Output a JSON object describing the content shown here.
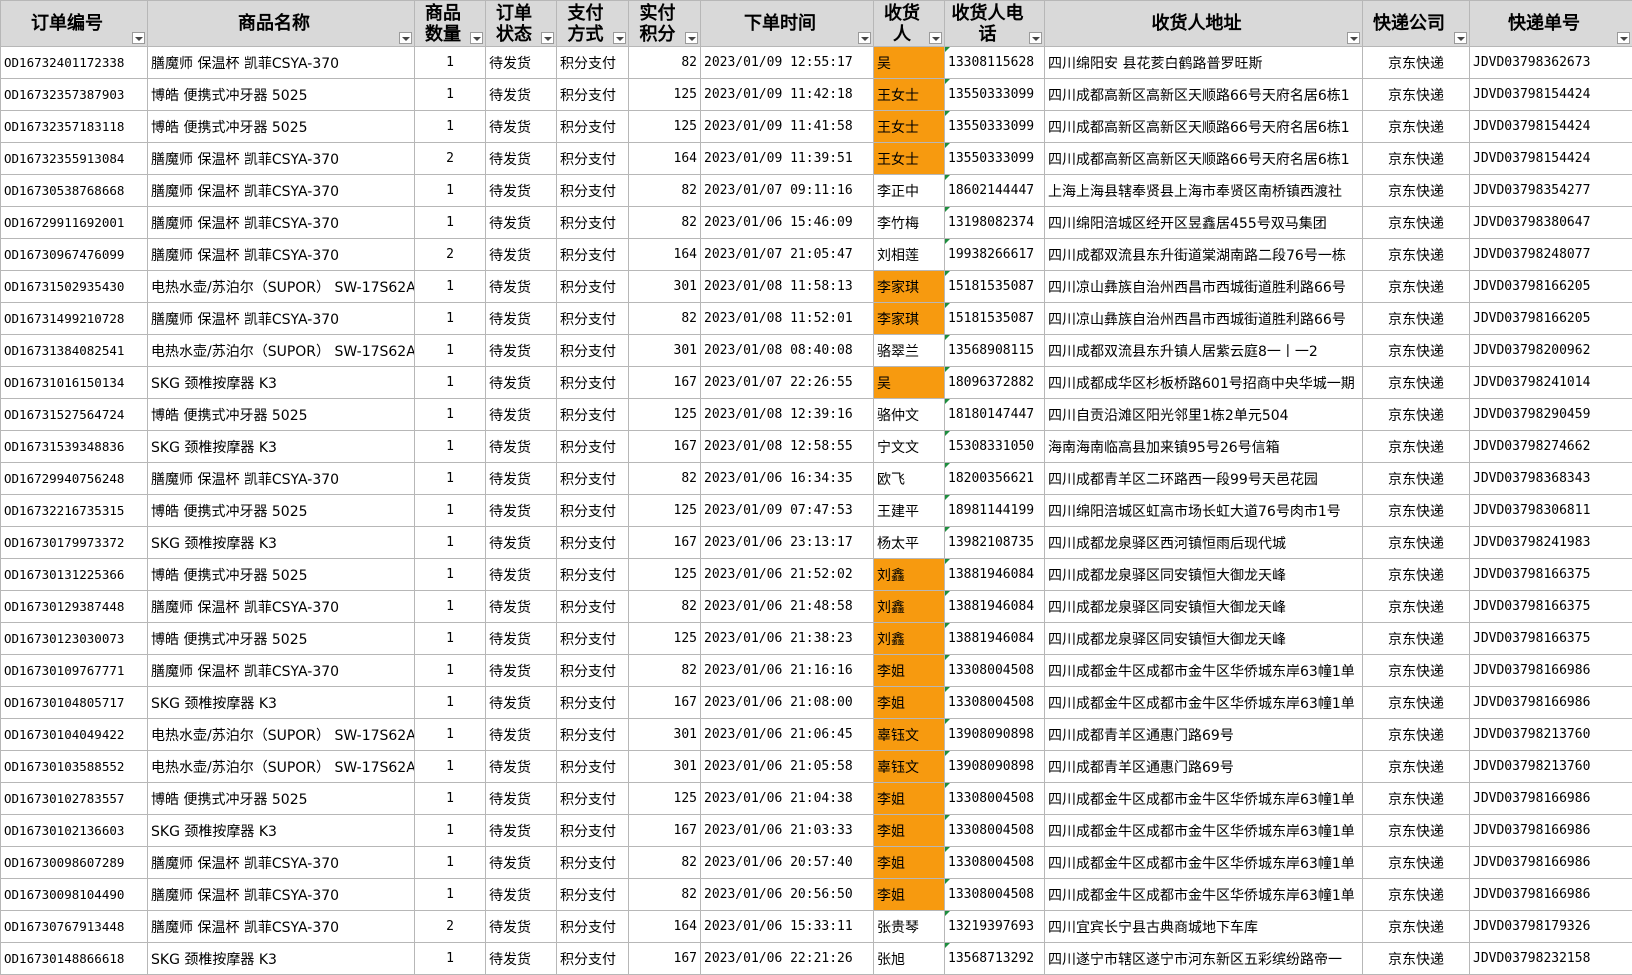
{
  "colors": {
    "header_bg": "#d9d9d9",
    "highlight": "#f79a0f",
    "grid": "#b7b7b7",
    "comment_marker": "#1e8e3e"
  },
  "icons": {
    "filter": "filter-dropdown-icon"
  },
  "columns": [
    {
      "key": "order_id",
      "label": "订单编号"
    },
    {
      "key": "product",
      "label": "商品名称"
    },
    {
      "key": "qty",
      "label": "商品数量"
    },
    {
      "key": "status",
      "label": "订单状态"
    },
    {
      "key": "payment",
      "label": "支付方式"
    },
    {
      "key": "points",
      "label": "实付积分"
    },
    {
      "key": "time",
      "label": "下单时间"
    },
    {
      "key": "receiver",
      "label": "收货人"
    },
    {
      "key": "phone",
      "label": "收货人电话"
    },
    {
      "key": "address",
      "label": "收货人地址"
    },
    {
      "key": "courier",
      "label": "快递公司"
    },
    {
      "key": "tracking",
      "label": "快递单号"
    }
  ],
  "rows": [
    {
      "order_id": "OD16732401172338",
      "product": "膳魔师 保温杯 凯菲CSYA-370",
      "qty": "1",
      "status": "待发货",
      "payment": "积分支付",
      "points": "82",
      "time": "2023/01/09 12:55:17",
      "receiver": "吴",
      "highlight": true,
      "phone": "13308115628",
      "address": "四川绵阳安  县花荄白鹤路普罗旺斯",
      "courier": "京东快递",
      "tracking": "JDVD03798362673"
    },
    {
      "order_id": "OD16732357387903",
      "product": "博皓 便携式冲牙器 5025",
      "qty": "1",
      "status": "待发货",
      "payment": "积分支付",
      "points": "125",
      "time": "2023/01/09 11:42:18",
      "receiver": "王女士",
      "highlight": true,
      "phone": "13550333099",
      "address": "四川成都高新区高新区天顺路66号天府名居6栋1",
      "courier": "京东快递",
      "tracking": "JDVD03798154424"
    },
    {
      "order_id": "OD16732357183118",
      "product": "博皓 便携式冲牙器 5025",
      "qty": "1",
      "status": "待发货",
      "payment": "积分支付",
      "points": "125",
      "time": "2023/01/09 11:41:58",
      "receiver": "王女士",
      "highlight": true,
      "phone": "13550333099",
      "address": "四川成都高新区高新区天顺路66号天府名居6栋1",
      "courier": "京东快递",
      "tracking": "JDVD03798154424"
    },
    {
      "order_id": "OD16732355913084",
      "product": "膳魔师 保温杯 凯菲CSYA-370",
      "qty": "2",
      "status": "待发货",
      "payment": "积分支付",
      "points": "164",
      "time": "2023/01/09 11:39:51",
      "receiver": "王女士",
      "highlight": true,
      "phone": "13550333099",
      "address": "四川成都高新区高新区天顺路66号天府名居6栋1",
      "courier": "京东快递",
      "tracking": "JDVD03798154424"
    },
    {
      "order_id": "OD16730538768668",
      "product": "膳魔师 保温杯 凯菲CSYA-370",
      "qty": "1",
      "status": "待发货",
      "payment": "积分支付",
      "points": "82",
      "time": "2023/01/07 09:11:16",
      "receiver": "李正中",
      "highlight": false,
      "phone": "18602144447",
      "address": "上海上海县辖奉贤县上海市奉贤区南桥镇西渡社",
      "courier": "京东快递",
      "tracking": "JDVD03798354277"
    },
    {
      "order_id": "OD16729911692001",
      "product": "膳魔师 保温杯 凯菲CSYA-370",
      "qty": "1",
      "status": "待发货",
      "payment": "积分支付",
      "points": "82",
      "time": "2023/01/06 15:46:09",
      "receiver": "李竹梅",
      "highlight": false,
      "phone": "13198082374",
      "address": "四川绵阳涪城区经开区昱鑫居455号双马集团",
      "courier": "京东快递",
      "tracking": "JDVD03798380647"
    },
    {
      "order_id": "OD16730967476099",
      "product": "膳魔师 保温杯 凯菲CSYA-370",
      "qty": "2",
      "status": "待发货",
      "payment": "积分支付",
      "points": "164",
      "time": "2023/01/07 21:05:47",
      "receiver": "刘相莲",
      "highlight": false,
      "phone": "19938266617",
      "address": "四川成都双流县东升街道棠湖南路二段76号一栋",
      "courier": "京东快递",
      "tracking": "JDVD03798248077"
    },
    {
      "order_id": "OD16731502935430",
      "product": "电热水壶/苏泊尔（SUPOR） SW-17S62A",
      "qty": "1",
      "status": "待发货",
      "payment": "积分支付",
      "points": "301",
      "time": "2023/01/08 11:58:13",
      "receiver": "李家琪",
      "highlight": true,
      "phone": "15181535087",
      "address": "四川凉山彝族自治州西昌市西城街道胜利路66号",
      "courier": "京东快递",
      "tracking": "JDVD03798166205"
    },
    {
      "order_id": "OD16731499210728",
      "product": "膳魔师 保温杯 凯菲CSYA-370",
      "qty": "1",
      "status": "待发货",
      "payment": "积分支付",
      "points": "82",
      "time": "2023/01/08 11:52:01",
      "receiver": "李家琪",
      "highlight": true,
      "phone": "15181535087",
      "address": "四川凉山彝族自治州西昌市西城街道胜利路66号",
      "courier": "京东快递",
      "tracking": "JDVD03798166205"
    },
    {
      "order_id": "OD16731384082541",
      "product": "电热水壶/苏泊尔（SUPOR） SW-17S62A",
      "qty": "1",
      "status": "待发货",
      "payment": "积分支付",
      "points": "301",
      "time": "2023/01/08 08:40:08",
      "receiver": "骆翠兰",
      "highlight": false,
      "phone": "13568908115",
      "address": "四川成都双流县东升镇人居紫云庭8一丨一2",
      "courier": "京东快递",
      "tracking": "JDVD03798200962"
    },
    {
      "order_id": "OD16731016150134",
      "product": "SKG 颈椎按摩器 K3",
      "qty": "1",
      "status": "待发货",
      "payment": "积分支付",
      "points": "167",
      "time": "2023/01/07 22:26:55",
      "receiver": "吴",
      "highlight": true,
      "phone": "18096372882",
      "address": "四川成都成华区杉板桥路601号招商中央华城一期",
      "courier": "京东快递",
      "tracking": "JDVD03798241014"
    },
    {
      "order_id": "OD16731527564724",
      "product": "博皓 便携式冲牙器 5025",
      "qty": "1",
      "status": "待发货",
      "payment": "积分支付",
      "points": "125",
      "time": "2023/01/08 12:39:16",
      "receiver": "骆仲文",
      "highlight": false,
      "phone": "18180147447",
      "address": "四川自贡沿滩区阳光邻里1栋2单元504",
      "courier": "京东快递",
      "tracking": "JDVD03798290459"
    },
    {
      "order_id": "OD16731539348836",
      "product": "SKG 颈椎按摩器 K3",
      "qty": "1",
      "status": "待发货",
      "payment": "积分支付",
      "points": "167",
      "time": "2023/01/08 12:58:55",
      "receiver": "宁文文",
      "highlight": false,
      "phone": "15308331050",
      "address": "海南海南临高县加来镇95号26号信箱",
      "courier": "京东快递",
      "tracking": "JDVD03798274662"
    },
    {
      "order_id": "OD16729940756248",
      "product": "膳魔师 保温杯 凯菲CSYA-370",
      "qty": "1",
      "status": "待发货",
      "payment": "积分支付",
      "points": "82",
      "time": "2023/01/06 16:34:35",
      "receiver": "欧飞",
      "highlight": false,
      "phone": "18200356621",
      "address": "四川成都青羊区二环路西一段99号天邑花园",
      "courier": "京东快递",
      "tracking": "JDVD03798368343"
    },
    {
      "order_id": "OD16732216735315",
      "product": "博皓 便携式冲牙器 5025",
      "qty": "1",
      "status": "待发货",
      "payment": "积分支付",
      "points": "125",
      "time": "2023/01/09 07:47:53",
      "receiver": "王建平",
      "highlight": false,
      "phone": "18981144199",
      "address": "四川绵阳涪城区虹高市场长虹大道76号肉市1号",
      "courier": "京东快递",
      "tracking": "JDVD03798306811"
    },
    {
      "order_id": "OD16730179973372",
      "product": "SKG 颈椎按摩器 K3",
      "qty": "1",
      "status": "待发货",
      "payment": "积分支付",
      "points": "167",
      "time": "2023/01/06 23:13:17",
      "receiver": "杨太平",
      "highlight": false,
      "phone": "13982108735",
      "address": "四川成都龙泉驿区西河镇恒雨后现代城",
      "courier": "京东快递",
      "tracking": "JDVD03798241983"
    },
    {
      "order_id": "OD16730131225366",
      "product": "博皓 便携式冲牙器 5025",
      "qty": "1",
      "status": "待发货",
      "payment": "积分支付",
      "points": "125",
      "time": "2023/01/06 21:52:02",
      "receiver": "刘鑫",
      "highlight": true,
      "phone": "13881946084",
      "address": "四川成都龙泉驿区同安镇恒大御龙天峰",
      "courier": "京东快递",
      "tracking": "JDVD03798166375"
    },
    {
      "order_id": "OD16730129387448",
      "product": "膳魔师 保温杯 凯菲CSYA-370",
      "qty": "1",
      "status": "待发货",
      "payment": "积分支付",
      "points": "82",
      "time": "2023/01/06 21:48:58",
      "receiver": "刘鑫",
      "highlight": true,
      "phone": "13881946084",
      "address": "四川成都龙泉驿区同安镇恒大御龙天峰",
      "courier": "京东快递",
      "tracking": "JDVD03798166375"
    },
    {
      "order_id": "OD16730123030073",
      "product": "博皓 便携式冲牙器 5025",
      "qty": "1",
      "status": "待发货",
      "payment": "积分支付",
      "points": "125",
      "time": "2023/01/06 21:38:23",
      "receiver": "刘鑫",
      "highlight": true,
      "phone": "13881946084",
      "address": "四川成都龙泉驿区同安镇恒大御龙天峰",
      "courier": "京东快递",
      "tracking": "JDVD03798166375"
    },
    {
      "order_id": "OD16730109767771",
      "product": "膳魔师 保温杯 凯菲CSYA-370",
      "qty": "1",
      "status": "待发货",
      "payment": "积分支付",
      "points": "82",
      "time": "2023/01/06 21:16:16",
      "receiver": "李姐",
      "highlight": true,
      "phone": "13308004508",
      "address": "四川成都金牛区成都市金牛区华侨城东岸63幢1单",
      "courier": "京东快递",
      "tracking": "JDVD03798166986"
    },
    {
      "order_id": "OD16730104805717",
      "product": "SKG 颈椎按摩器 K3",
      "qty": "1",
      "status": "待发货",
      "payment": "积分支付",
      "points": "167",
      "time": "2023/01/06 21:08:00",
      "receiver": "李姐",
      "highlight": true,
      "phone": "13308004508",
      "address": "四川成都金牛区成都市金牛区华侨城东岸63幢1单",
      "courier": "京东快递",
      "tracking": "JDVD03798166986"
    },
    {
      "order_id": "OD16730104049422",
      "product": "电热水壶/苏泊尔（SUPOR） SW-17S62A",
      "qty": "1",
      "status": "待发货",
      "payment": "积分支付",
      "points": "301",
      "time": "2023/01/06 21:06:45",
      "receiver": "辜钰文",
      "highlight": true,
      "phone": "13908090898",
      "address": "四川成都青羊区通惠门路69号",
      "courier": "京东快递",
      "tracking": "JDVD03798213760"
    },
    {
      "order_id": "OD16730103588552",
      "product": "电热水壶/苏泊尔（SUPOR） SW-17S62A",
      "qty": "1",
      "status": "待发货",
      "payment": "积分支付",
      "points": "301",
      "time": "2023/01/06 21:05:58",
      "receiver": "辜钰文",
      "highlight": true,
      "phone": "13908090898",
      "address": "四川成都青羊区通惠门路69号",
      "courier": "京东快递",
      "tracking": "JDVD03798213760"
    },
    {
      "order_id": "OD16730102783557",
      "product": "博皓 便携式冲牙器 5025",
      "qty": "1",
      "status": "待发货",
      "payment": "积分支付",
      "points": "125",
      "time": "2023/01/06 21:04:38",
      "receiver": "李姐",
      "highlight": true,
      "phone": "13308004508",
      "address": "四川成都金牛区成都市金牛区华侨城东岸63幢1单",
      "courier": "京东快递",
      "tracking": "JDVD03798166986"
    },
    {
      "order_id": "OD16730102136603",
      "product": "SKG 颈椎按摩器 K3",
      "qty": "1",
      "status": "待发货",
      "payment": "积分支付",
      "points": "167",
      "time": "2023/01/06 21:03:33",
      "receiver": "李姐",
      "highlight": true,
      "phone": "13308004508",
      "address": "四川成都金牛区成都市金牛区华侨城东岸63幢1单",
      "courier": "京东快递",
      "tracking": "JDVD03798166986"
    },
    {
      "order_id": "OD16730098607289",
      "product": "膳魔师 保温杯 凯菲CSYA-370",
      "qty": "1",
      "status": "待发货",
      "payment": "积分支付",
      "points": "82",
      "time": "2023/01/06 20:57:40",
      "receiver": "李姐",
      "highlight": true,
      "phone": "13308004508",
      "address": "四川成都金牛区成都市金牛区华侨城东岸63幢1单",
      "courier": "京东快递",
      "tracking": "JDVD03798166986"
    },
    {
      "order_id": "OD16730098104490",
      "product": "膳魔师 保温杯 凯菲CSYA-370",
      "qty": "1",
      "status": "待发货",
      "payment": "积分支付",
      "points": "82",
      "time": "2023/01/06 20:56:50",
      "receiver": "李姐",
      "highlight": true,
      "phone": "13308004508",
      "address": "四川成都金牛区成都市金牛区华侨城东岸63幢1单",
      "courier": "京东快递",
      "tracking": "JDVD03798166986"
    },
    {
      "order_id": "OD16730767913448",
      "product": "膳魔师 保温杯 凯菲CSYA-370",
      "qty": "2",
      "status": "待发货",
      "payment": "积分支付",
      "points": "164",
      "time": "2023/01/06 15:33:11",
      "receiver": "张贵琴",
      "highlight": false,
      "phone": "13219397693",
      "address": "四川宜宾长宁县古典商城地下车库",
      "courier": "京东快递",
      "tracking": "JDVD03798179326"
    },
    {
      "order_id": "OD16730148866618",
      "product": "SKG 颈椎按摩器 K3",
      "qty": "1",
      "status": "待发货",
      "payment": "积分支付",
      "points": "167",
      "time": "2023/01/06 22:21:26",
      "receiver": "张旭",
      "highlight": false,
      "phone": "13568713292",
      "address": "四川遂宁市辖区遂宁市河东新区五彩缤纷路帝一",
      "courier": "京东快递",
      "tracking": "JDVD03798232158"
    }
  ]
}
